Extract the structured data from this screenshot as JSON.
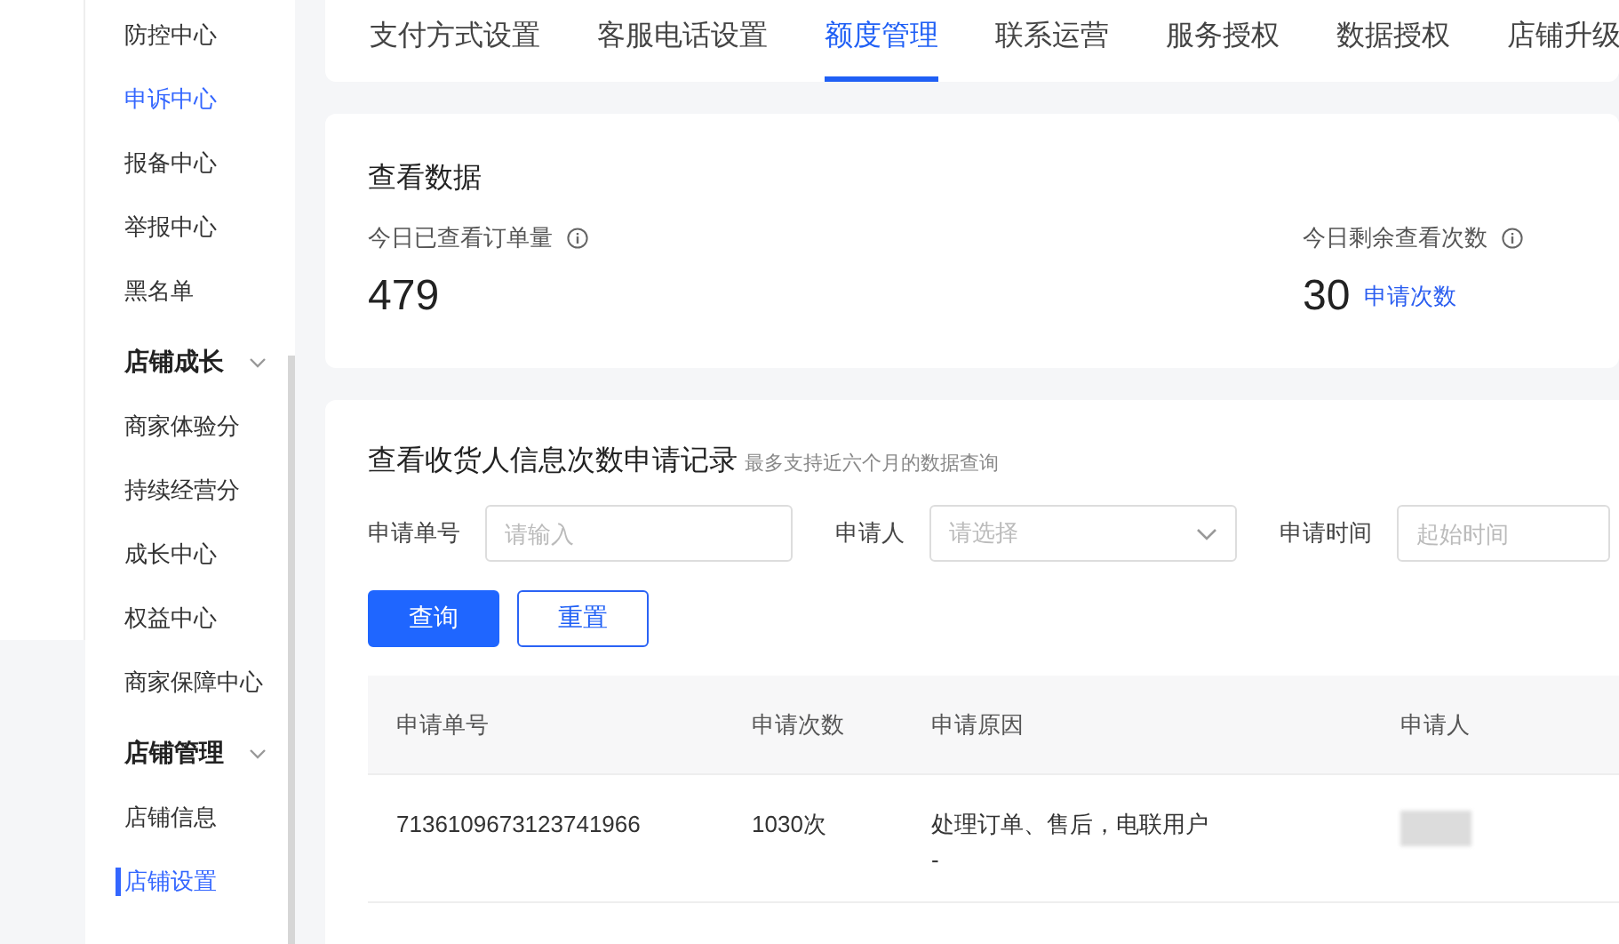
{
  "sidebar": {
    "items": [
      {
        "label": "防控中心",
        "selected": false,
        "highlighted": false
      },
      {
        "label": "申诉中心",
        "selected": false,
        "highlighted": true
      },
      {
        "label": "报备中心",
        "selected": false,
        "highlighted": false
      },
      {
        "label": "举报中心",
        "selected": false,
        "highlighted": false
      },
      {
        "label": "黑名单",
        "selected": false,
        "highlighted": false
      }
    ],
    "groups": [
      {
        "heading": "店铺成长",
        "expanded": true,
        "items": [
          {
            "label": "商家体验分",
            "selected": false,
            "highlighted": false
          },
          {
            "label": "持续经营分",
            "selected": false,
            "highlighted": false
          },
          {
            "label": "成长中心",
            "selected": false,
            "highlighted": false
          },
          {
            "label": "权益中心",
            "selected": false,
            "highlighted": false
          },
          {
            "label": "商家保障中心",
            "selected": false,
            "highlighted": false
          }
        ]
      },
      {
        "heading": "店铺管理",
        "expanded": true,
        "items": [
          {
            "label": "店铺信息",
            "selected": false,
            "highlighted": false
          },
          {
            "label": "店铺设置",
            "selected": true,
            "highlighted": true
          }
        ]
      }
    ]
  },
  "tabs": [
    {
      "label": "支付方式设置",
      "selected": false
    },
    {
      "label": "客服电话设置",
      "selected": false
    },
    {
      "label": "额度管理",
      "selected": true
    },
    {
      "label": "联系运营",
      "selected": false
    },
    {
      "label": "服务授权",
      "selected": false
    },
    {
      "label": "数据授权",
      "selected": false
    },
    {
      "label": "店铺升级",
      "selected": false
    }
  ],
  "stats": {
    "title": "查看数据",
    "items": [
      {
        "label": "今日已查看订单量",
        "value": "479"
      },
      {
        "label": "今日剩余查看次数",
        "value": "30",
        "link": "申请次数"
      }
    ]
  },
  "records": {
    "title": "查看收货人信息次数申请记录",
    "subtitle": "最多支持近六个月的数据查询",
    "filters": [
      {
        "kind": "input",
        "label": "申请单号",
        "placeholder": "请输入"
      },
      {
        "kind": "select",
        "label": "申请人",
        "placeholder": "请选择"
      },
      {
        "kind": "date",
        "label": "申请时间",
        "placeholder": "起始时间"
      }
    ],
    "buttons": [
      {
        "label": "查询",
        "kind": "primary"
      },
      {
        "label": "重置",
        "kind": "outline"
      }
    ],
    "table": {
      "columns": [
        "申请单号",
        "申请次数",
        "申请原因",
        "申请人"
      ],
      "rows": [
        {
          "cells": [
            "7136109673123741966",
            "1030次",
            "处理订单、售后，电联用户\n-"
          ],
          "applicant_blurred": true
        }
      ]
    }
  }
}
